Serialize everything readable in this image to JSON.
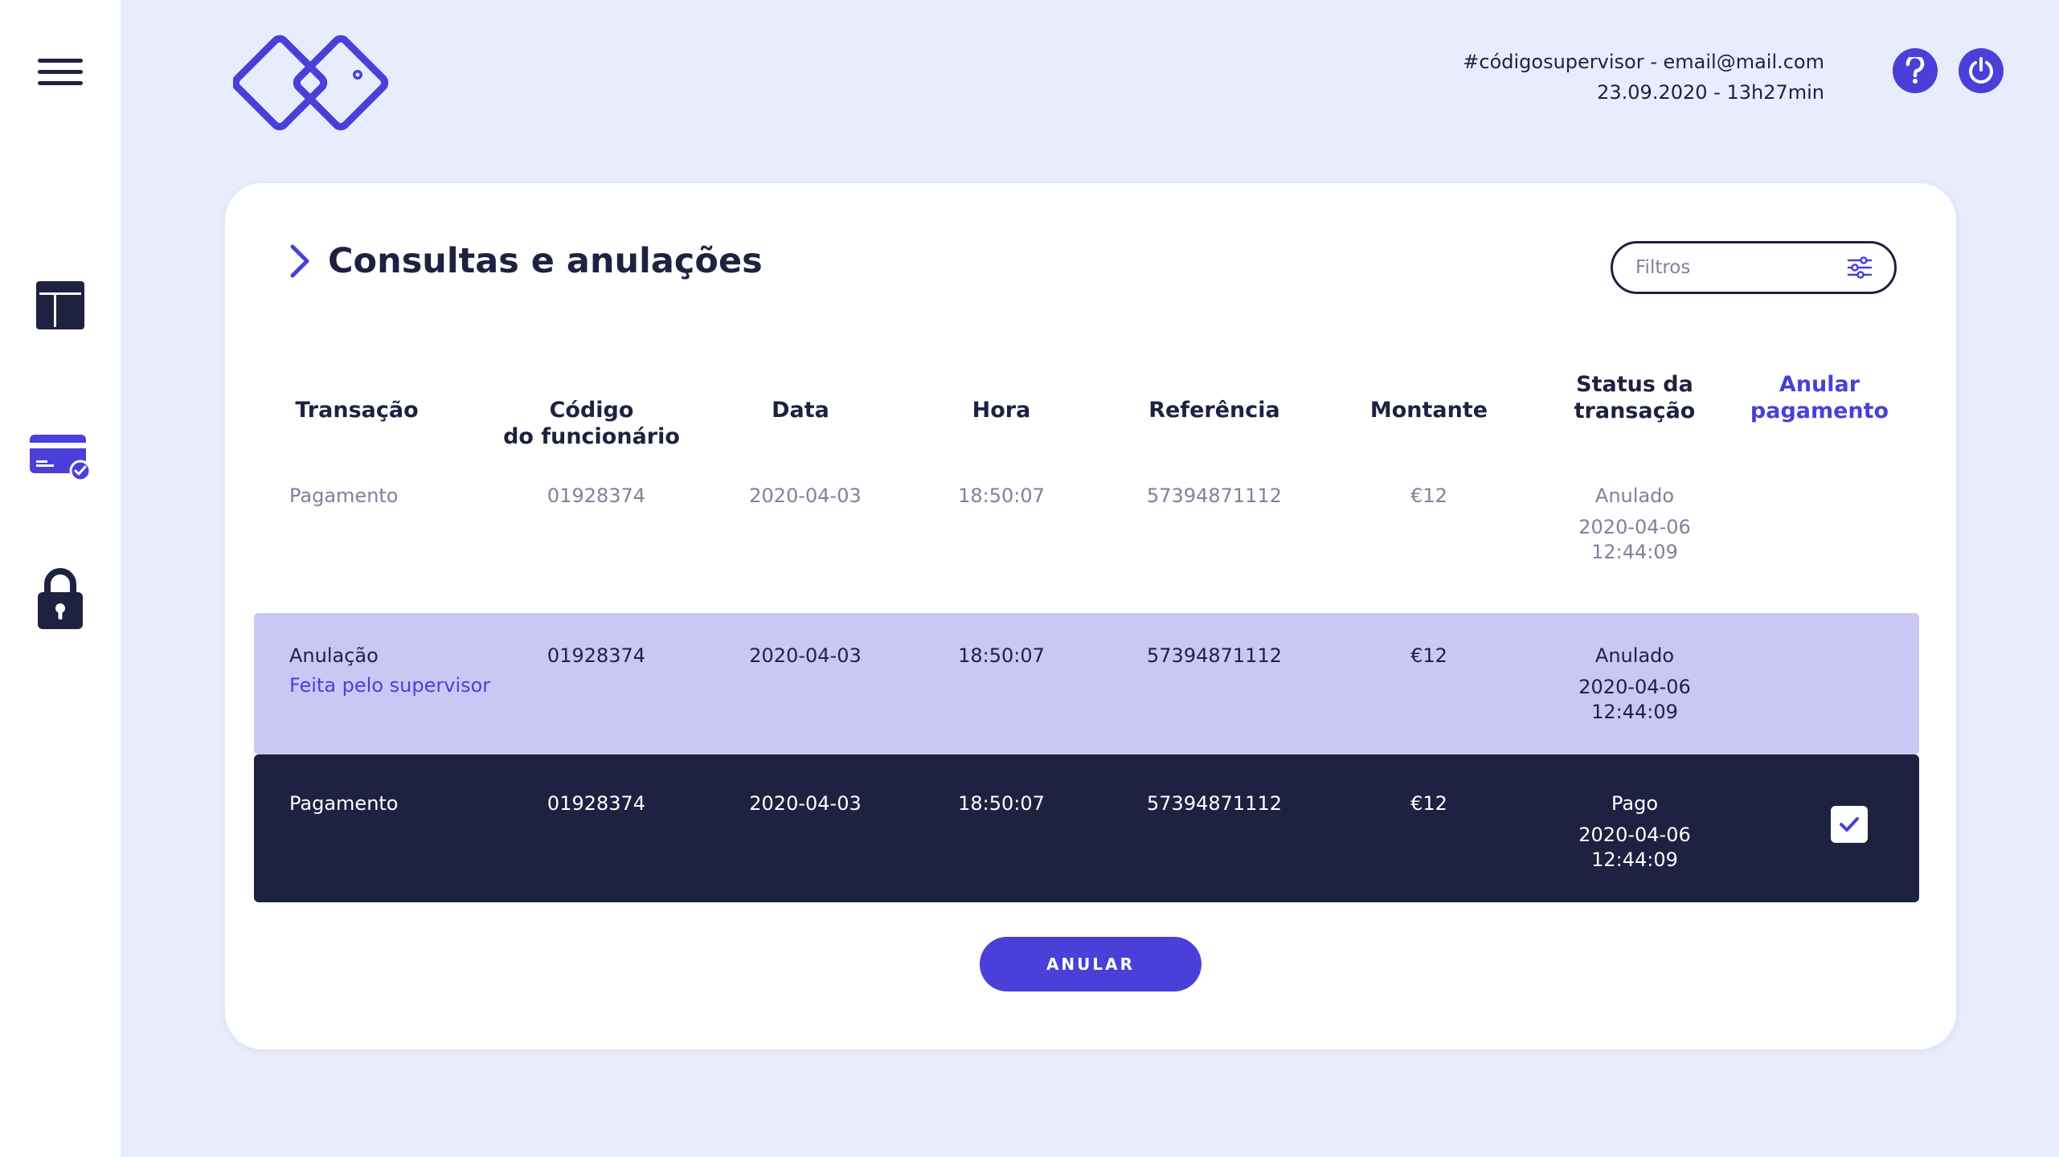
{
  "header": {
    "user_line": "#códigosupervisor - email@mail.com",
    "datetime_line": "23.09.2020 - 13h27min"
  },
  "sidebar": {
    "items": [
      {
        "icon": "menu-icon"
      },
      {
        "icon": "layout-icon"
      },
      {
        "icon": "card-check-icon"
      },
      {
        "icon": "lock-icon"
      }
    ]
  },
  "page": {
    "title": "Consultas e anulações",
    "filter_placeholder": "Filtros"
  },
  "table": {
    "columns": {
      "transacao": "Transação",
      "codigo_l1": "Código",
      "codigo_l2": "do funcionário",
      "data": "Data",
      "hora": "Hora",
      "referencia": "Referência",
      "montante": "Montante",
      "status_l1": "Status da",
      "status_l2": "transação",
      "anular_l1": "Anular",
      "anular_l2": "pagamento"
    },
    "rows": [
      {
        "transacao": "Pagamento",
        "sub": "",
        "codigo": "01928374",
        "data": "2020-04-03",
        "hora": "18:50:07",
        "referencia": "57394871112",
        "montante": "€12",
        "status": "Anulado",
        "status_date": "2020-04-06",
        "status_time": "12:44:09",
        "checked": false
      },
      {
        "transacao": "Anulação",
        "sub": "Feita pelo supervisor",
        "codigo": "01928374",
        "data": "2020-04-03",
        "hora": "18:50:07",
        "referencia": "57394871112",
        "montante": "€12",
        "status": "Anulado",
        "status_date": "2020-04-06",
        "status_time": "12:44:09",
        "checked": false
      },
      {
        "transacao": "Pagamento",
        "sub": "",
        "codigo": "01928374",
        "data": "2020-04-03",
        "hora": "18:50:07",
        "referencia": "57394871112",
        "montante": "€12",
        "status": "Pago",
        "status_date": "2020-04-06",
        "status_time": "12:44:09",
        "checked": true
      }
    ]
  },
  "actions": {
    "anular_label": "ANULAR"
  },
  "colors": {
    "accent": "#4A3FD9",
    "dark": "#1E2140",
    "background": "#E9ECFC",
    "highlight_row": "#CAC7F4"
  }
}
